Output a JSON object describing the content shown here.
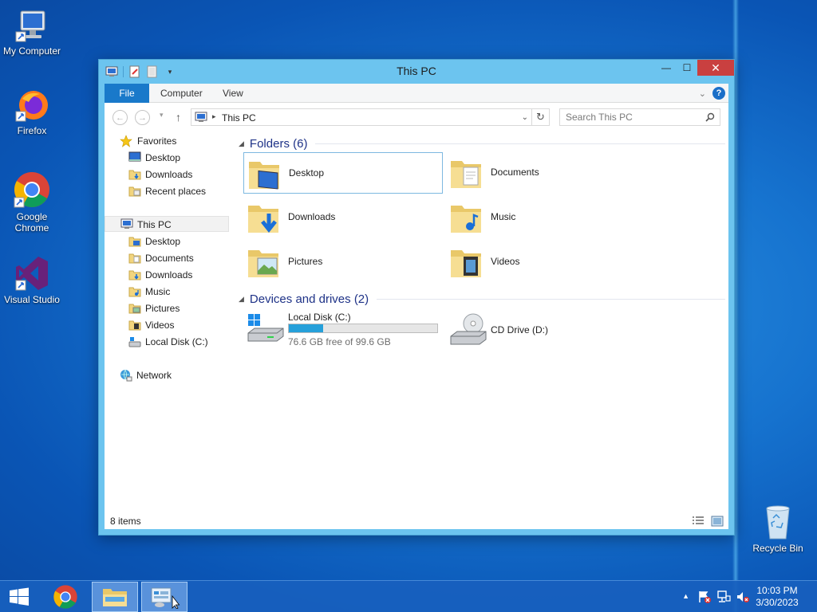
{
  "desktop": {
    "icons": [
      {
        "label": "My Computer"
      },
      {
        "label": "Firefox"
      },
      {
        "label": "Google Chrome"
      },
      {
        "label": "Visual Studio"
      },
      {
        "label": "Recycle Bin"
      }
    ]
  },
  "window": {
    "title": "This PC",
    "close_glyph": "✕",
    "maximize_glyph": "☐",
    "minimize_glyph": "—"
  },
  "ribbon": {
    "tabs": [
      "File",
      "Computer",
      "View"
    ]
  },
  "navbar": {
    "back_glyph": "←",
    "forward_glyph": "→",
    "up_glyph": "↑",
    "address": "This PC",
    "search_placeholder": "Search This PC"
  },
  "navpane": {
    "favorites": "Favorites",
    "favorites_items": [
      "Desktop",
      "Downloads",
      "Recent places"
    ],
    "thispc": "This PC",
    "thispc_items": [
      "Desktop",
      "Documents",
      "Downloads",
      "Music",
      "Pictures",
      "Videos",
      "Local Disk (C:)"
    ],
    "network": "Network"
  },
  "content": {
    "folders_header": "Folders (6)",
    "folders": [
      "Desktop",
      "Documents",
      "Downloads",
      "Music",
      "Pictures",
      "Videos"
    ],
    "devices_header": "Devices and drives (2)",
    "drives": [
      {
        "name": "Local Disk (C:)",
        "free_text": "76.6 GB free of 99.6 GB",
        "used_fraction": 0.231
      },
      {
        "name": "CD Drive (D:)"
      }
    ]
  },
  "statusbar": {
    "items_count": "8 items"
  },
  "taskbar": {
    "time": "10:03 PM",
    "date": "3/30/2023"
  },
  "colors": {
    "accent": "#1979ca",
    "close": "#c94040",
    "window_frame": "#6cc4ef",
    "drive_bar": "#26a0da",
    "group_header": "#1e3287"
  }
}
